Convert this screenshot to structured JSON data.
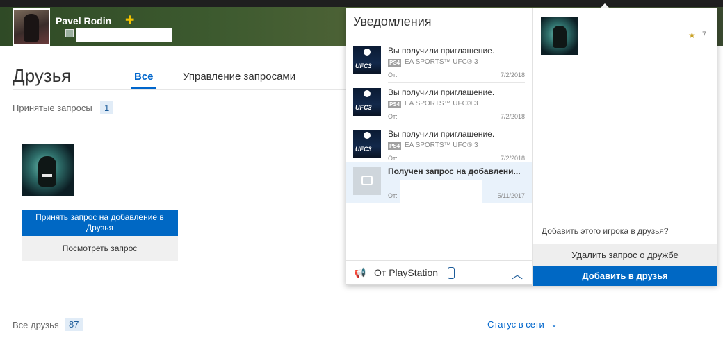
{
  "profile": {
    "name": "Pavel Rodin",
    "name_icon": "ps-plus-icon"
  },
  "friends": {
    "title": "Друзья",
    "tabs": [
      {
        "label": "Все",
        "active": true
      },
      {
        "label": "Управление запросами",
        "active": false
      }
    ],
    "accepted_label": "Принятые запросы",
    "accepted_count": "1",
    "accept_button": "Принять запрос на добавление в Друзья",
    "view_button": "Посмотреть запрос",
    "all_label": "Все друзья",
    "all_count": "87",
    "status_filter": "Статус в сети"
  },
  "notifications": {
    "title": "Уведомления",
    "items": [
      {
        "headline": "Вы получили приглашение.",
        "platform": "PS4",
        "game": "EA SPORTS™ UFC® 3",
        "from": "От:",
        "date": "7/2/2018",
        "thumb_text": "UFC3"
      },
      {
        "headline": "Вы получили приглашение.",
        "platform": "PS4",
        "game": "EA SPORTS™ UFC® 3",
        "from": "От:",
        "date": "7/2/2018",
        "thumb_text": "UFC3"
      },
      {
        "headline": "Вы получили приглашение.",
        "platform": "PS4",
        "game": "EA SPORTS™ UFC® 3",
        "from": "От:",
        "date": "7/2/2018",
        "thumb_text": "UFC3"
      },
      {
        "headline": "Получен запрос на добавлени...",
        "from": "От:",
        "date": "5/11/2017"
      }
    ],
    "footer_label": "От PlayStation"
  },
  "detail": {
    "trophy_level": "7",
    "prompt": "Добавить этого игрока в друзья?",
    "delete_button": "Удалить запрос о дружбе",
    "add_button": "Добавить в друзья"
  },
  "colors": {
    "accent": "#0068c4",
    "link": "#0066cc",
    "badge_bg": "#e1ecf7",
    "plus": "#f2c200"
  }
}
